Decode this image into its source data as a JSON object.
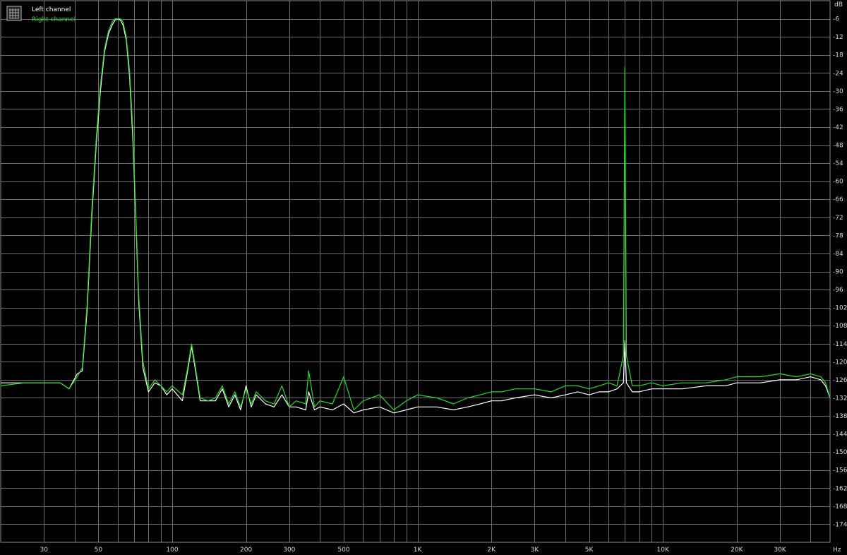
{
  "chart_data": {
    "type": "line",
    "title": "",
    "xlabel": "Hz",
    "ylabel": "dB",
    "x_scale": "log",
    "xlim": [
      20,
      48000
    ],
    "ylim": [
      -180,
      0
    ],
    "grid": true,
    "legend_position": "top-left",
    "colors": {
      "background": "#000000",
      "grid": "#6e6e6e",
      "axis_text": "#d9d9d9",
      "left": "#ffffff",
      "right": "#22dd22"
    },
    "x_ticks": [
      {
        "value": 30,
        "label": "30"
      },
      {
        "value": 50,
        "label": "50"
      },
      {
        "value": 100,
        "label": "100"
      },
      {
        "value": 200,
        "label": "200"
      },
      {
        "value": 300,
        "label": "300"
      },
      {
        "value": 500,
        "label": "500"
      },
      {
        "value": 1000,
        "label": "1K"
      },
      {
        "value": 2000,
        "label": "2K"
      },
      {
        "value": 3000,
        "label": "3K"
      },
      {
        "value": 5000,
        "label": "5K"
      },
      {
        "value": 10000,
        "label": "10K"
      },
      {
        "value": 20000,
        "label": "20K"
      },
      {
        "value": 30000,
        "label": "30K"
      }
    ],
    "y_ticks": [
      {
        "value": -6,
        "label": "-6"
      },
      {
        "value": -12,
        "label": "-12"
      },
      {
        "value": -18,
        "label": "-18"
      },
      {
        "value": -24,
        "label": "-24"
      },
      {
        "value": -30,
        "label": "-30"
      },
      {
        "value": -36,
        "label": "-36"
      },
      {
        "value": -42,
        "label": "-42"
      },
      {
        "value": -48,
        "label": "-48"
      },
      {
        "value": -54,
        "label": "-54"
      },
      {
        "value": -60,
        "label": "-60"
      },
      {
        "value": -66,
        "label": "-66"
      },
      {
        "value": -72,
        "label": "-72"
      },
      {
        "value": -78,
        "label": "-78"
      },
      {
        "value": -84,
        "label": "-84"
      },
      {
        "value": -90,
        "label": "-90"
      },
      {
        "value": -96,
        "label": "-96"
      },
      {
        "value": -102,
        "label": "-102"
      },
      {
        "value": -108,
        "label": "-108"
      },
      {
        "value": -114,
        "label": "-114"
      },
      {
        "value": -120,
        "label": "-120"
      },
      {
        "value": -126,
        "label": "-126"
      },
      {
        "value": -132,
        "label": "-132"
      },
      {
        "value": -138,
        "label": "-138"
      },
      {
        "value": -144,
        "label": "-144"
      },
      {
        "value": -150,
        "label": "-150"
      },
      {
        "value": -156,
        "label": "-156"
      },
      {
        "value": -162,
        "label": "-162"
      },
      {
        "value": -168,
        "label": "-168"
      },
      {
        "value": -174,
        "label": "-174"
      }
    ],
    "series": [
      {
        "name": "Left channel",
        "x": [
          20,
          25,
          30,
          35,
          38,
          41,
          43,
          45,
          47,
          49,
          51,
          53,
          55,
          57,
          58.5,
          60,
          61.5,
          63,
          65,
          67,
          69,
          71,
          73,
          76,
          80,
          85,
          90,
          95,
          100,
          110,
          115,
          120,
          125,
          130,
          140,
          150,
          160,
          170,
          180,
          190,
          200,
          210,
          220,
          240,
          260,
          280,
          300,
          320,
          350,
          360,
          380,
          400,
          450,
          500,
          550,
          600,
          700,
          800,
          900,
          1000,
          1200,
          1400,
          1600,
          1800,
          2000,
          2200,
          2500,
          3000,
          3500,
          4000,
          4500,
          5000,
          5500,
          6000,
          6500,
          6900,
          7000,
          7100,
          7500,
          8000,
          9000,
          10000,
          12000,
          15000,
          18000,
          20000,
          25000,
          30000,
          35000,
          40000,
          44000,
          46000,
          48000
        ],
        "values": [
          -127,
          -127,
          -127,
          -127,
          -129,
          -124,
          -123,
          -103,
          -72,
          -48,
          -30,
          -17,
          -11,
          -8,
          -6.5,
          -6,
          -6.5,
          -8,
          -13,
          -25,
          -45,
          -72,
          -100,
          -122,
          -130,
          -127,
          -128,
          -131,
          -129,
          -133,
          -124,
          -115,
          -124,
          -133,
          -133,
          -133,
          -129,
          -135,
          -131,
          -136,
          -128,
          -135,
          -131,
          -134,
          -135,
          -131,
          -135,
          -135,
          -136,
          -130,
          -136,
          -135,
          -136,
          -134,
          -137,
          -136,
          -135,
          -137,
          -136,
          -135,
          -135,
          -136,
          -135,
          -134,
          -133,
          -133,
          -132,
          -131,
          -132,
          -131,
          -130,
          -131,
          -130,
          -130,
          -129,
          -127,
          -113,
          -127,
          -130,
          -130,
          -129,
          -129,
          -129,
          -128,
          -128,
          -127,
          -127,
          -126,
          -126,
          -125,
          -126,
          -128,
          -132
        ]
      },
      {
        "name": "Right channel",
        "x": [
          20,
          25,
          30,
          35,
          38,
          41,
          43,
          45,
          47,
          49,
          51,
          53,
          55,
          57,
          58.5,
          60,
          61.5,
          63,
          65,
          67,
          69,
          71,
          73,
          76,
          80,
          85,
          90,
          95,
          100,
          110,
          115,
          120,
          125,
          130,
          140,
          150,
          160,
          170,
          180,
          190,
          200,
          210,
          220,
          240,
          260,
          280,
          300,
          320,
          350,
          360,
          380,
          400,
          450,
          500,
          550,
          600,
          700,
          800,
          900,
          1000,
          1200,
          1400,
          1600,
          1800,
          2000,
          2200,
          2500,
          3000,
          3500,
          4000,
          4500,
          5000,
          5500,
          6000,
          6500,
          6900,
          7000,
          7100,
          7500,
          8000,
          9000,
          10000,
          12000,
          15000,
          18000,
          20000,
          25000,
          30000,
          35000,
          40000,
          44000,
          46000,
          48000
        ],
        "values": [
          -128,
          -127,
          -127,
          -127,
          -129,
          -125,
          -122,
          -101,
          -70,
          -46,
          -28,
          -16,
          -10,
          -7,
          -6,
          -6,
          -6,
          -7,
          -12,
          -23,
          -42,
          -70,
          -98,
          -120,
          -129,
          -126,
          -128,
          -130,
          -128,
          -131,
          -123,
          -114,
          -123,
          -132,
          -133,
          -132,
          -128,
          -134,
          -130,
          -135,
          -129,
          -134,
          -130,
          -133,
          -134,
          -128,
          -135,
          -133,
          -134,
          -123,
          -135,
          -133,
          -134,
          -125,
          -136,
          -133,
          -131,
          -136,
          -133,
          -131,
          -132,
          -134,
          -132,
          -131,
          -130,
          -130,
          -129,
          -129,
          -130,
          -128,
          -128,
          -129,
          -128,
          -127,
          -128,
          -118,
          -22,
          -118,
          -128,
          -128,
          -127,
          -128,
          -127,
          -127,
          -126,
          -125,
          -125,
          -124,
          -125,
          -124,
          -125,
          -127,
          -132
        ]
      }
    ]
  }
}
